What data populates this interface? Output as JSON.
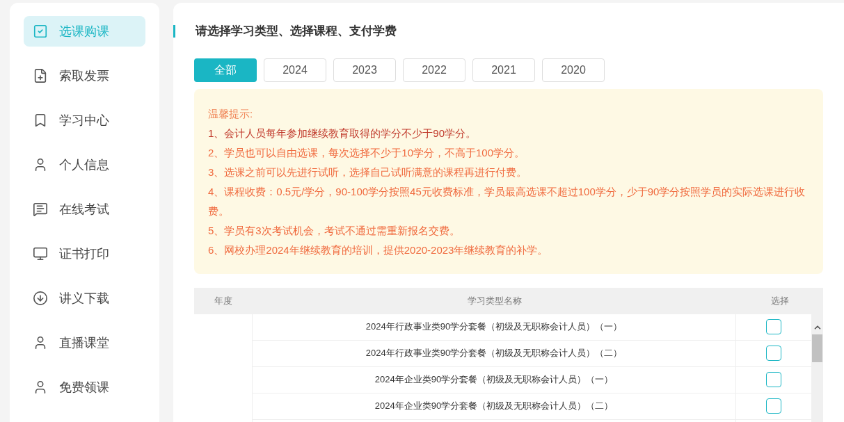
{
  "sidebar": {
    "items": [
      {
        "label": "选课购课",
        "selected": true
      },
      {
        "label": "索取发票",
        "selected": false
      },
      {
        "label": "学习中心",
        "selected": false
      },
      {
        "label": "个人信息",
        "selected": false
      },
      {
        "label": "在线考试",
        "selected": false
      },
      {
        "label": "证书打印",
        "selected": false
      },
      {
        "label": "讲义下载",
        "selected": false
      },
      {
        "label": "直播课堂",
        "selected": false
      },
      {
        "label": "免费领课",
        "selected": false
      }
    ]
  },
  "title": "请选择学习类型、选择课程、支付学费",
  "tabs": [
    {
      "label": "全部",
      "selected": true
    },
    {
      "label": "2024",
      "selected": false
    },
    {
      "label": "2023",
      "selected": false
    },
    {
      "label": "2022",
      "selected": false
    },
    {
      "label": "2021",
      "selected": false
    },
    {
      "label": "2020",
      "selected": false
    }
  ],
  "notice": {
    "heading": "温馨提示:",
    "lines": [
      {
        "text": "1、会计人员每年参加继续教育取得的学分不少于90学分。",
        "kind": "strong"
      },
      {
        "text": "2、学员也可以自由选课，每次选择不少于10学分，不高于100学分。",
        "kind": "normal"
      },
      {
        "text": "3、选课之前可以先进行试听，选择自己试听满意的课程再进行付费。",
        "kind": "normal"
      },
      {
        "text": "4、课程收费：0.5元/学分，90-100学分按照45元收费标准，学员最高选课不超过100学分，少于90学分按照学员的实际选课进行收费。",
        "kind": "normal"
      },
      {
        "text": "5、学员有3次考试机会，考试不通过需重新报名交费。",
        "kind": "normal"
      },
      {
        "text": "6、网校办理2024年继续教育的培训，提供2020-2023年继续教育的补学。",
        "kind": "normal"
      }
    ]
  },
  "table": {
    "columns": [
      "年度",
      "学习类型名称",
      "选择"
    ],
    "rows": [
      {
        "name": "2024年行政事业类90学分套餐（初级及无职称会计人员）（一）",
        "checked": false
      },
      {
        "name": "2024年行政事业类90学分套餐（初级及无职称会计人员）（二）",
        "checked": false
      },
      {
        "name": "2024年企业类90学分套餐（初级及无职称会计人员）（一）",
        "checked": false
      },
      {
        "name": "2024年企业类90学分套餐（初级及无职称会计人员）（二）",
        "checked": false
      }
    ]
  }
}
